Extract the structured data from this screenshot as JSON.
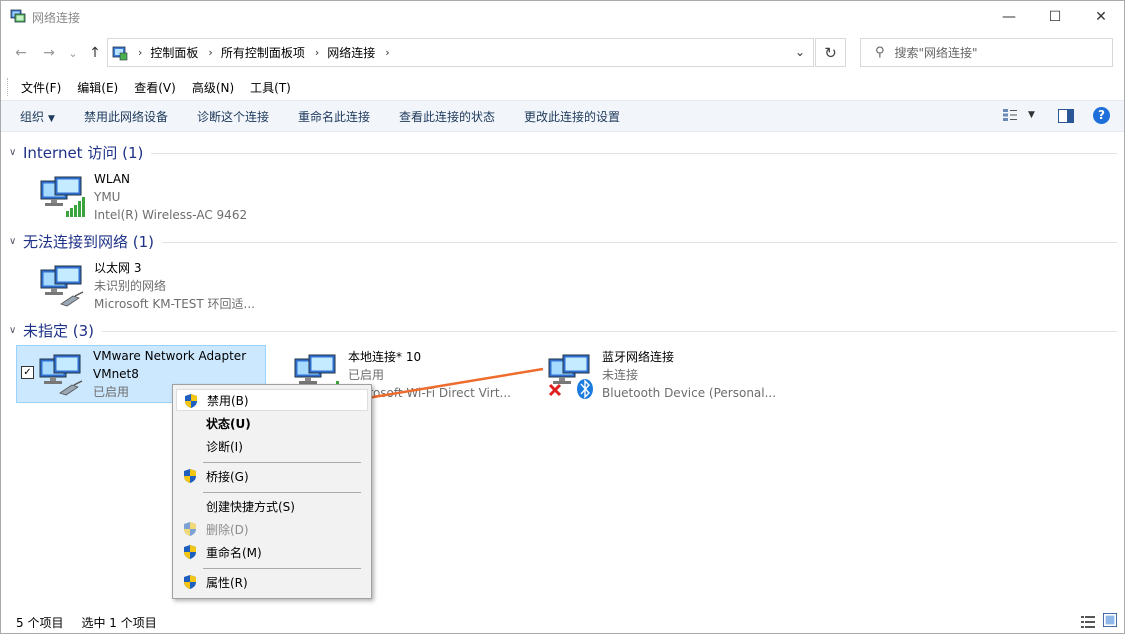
{
  "window": {
    "title": "网络连接",
    "minimize_glyph": "—",
    "maximize_glyph": "☐",
    "close_glyph": "✕"
  },
  "nav": {
    "back_glyph": "←",
    "forward_glyph": "→",
    "recent_glyph": "⌄",
    "up_glyph": "↑",
    "breadcrumbs": [
      "控制面板",
      "所有控制面板项",
      "网络连接"
    ],
    "refresh_glyph": "↻",
    "search_placeholder": "搜索\"网络连接\""
  },
  "menu": {
    "items": [
      "文件(F)",
      "编辑(E)",
      "查看(V)",
      "高级(N)",
      "工具(T)"
    ]
  },
  "commands": {
    "organize": "组织",
    "items": [
      "禁用此网络设备",
      "诊断这个连接",
      "重命名此连接",
      "查看此连接的状态",
      "更改此连接的设置"
    ],
    "help": "?"
  },
  "groups": [
    {
      "title": "Internet 访问 (1)",
      "items": [
        {
          "name": "WLAN",
          "line2": "YMU",
          "line3": "Intel(R) Wireless-AC 9462",
          "icon": "wireless-network-icon"
        }
      ]
    },
    {
      "title": "无法连接到网络 (1)",
      "items": [
        {
          "name": "以太网 3",
          "line2": "未识别的网络",
          "line3": "Microsoft KM-TEST 环回适...",
          "icon": "ethernet-network-icon"
        }
      ]
    },
    {
      "title": "未指定 (3)",
      "items": [
        {
          "name": "VMware Network Adapter",
          "line2": "VMnet8",
          "line3": "已启用",
          "icon": "ethernet-network-icon",
          "selected": true
        },
        {
          "name": "本地连接* 10",
          "line2": "已启用",
          "line3": "Microsoft Wi-Fi Direct Virt...",
          "icon": "wireless-network-icon"
        },
        {
          "name": "蓝牙网络连接",
          "line2": "未连接",
          "line3": "Bluetooth Device (Personal...",
          "icon": "bluetooth-network-icon"
        }
      ]
    }
  ],
  "context_menu": {
    "items": [
      {
        "label": "禁用(B)",
        "shield": true,
        "highlighted": true
      },
      {
        "label": "状态(U)",
        "bold": true
      },
      {
        "label": "诊断(I)"
      },
      {
        "label": "桥接(G)",
        "shield": true
      },
      {
        "label": "创建快捷方式(S)"
      },
      {
        "label": "删除(D)",
        "shield": true,
        "disabled": true
      },
      {
        "label": "重命名(M)",
        "shield": true
      },
      {
        "label": "属性(R)",
        "shield": true
      }
    ]
  },
  "status": {
    "count": "5 个项目",
    "selected": "选中 1 个项目"
  },
  "colors": {
    "accent": "#1e6fd9",
    "group_title": "#1e3287",
    "selection": "#cce8ff",
    "arrow": "#ee6c2d"
  }
}
